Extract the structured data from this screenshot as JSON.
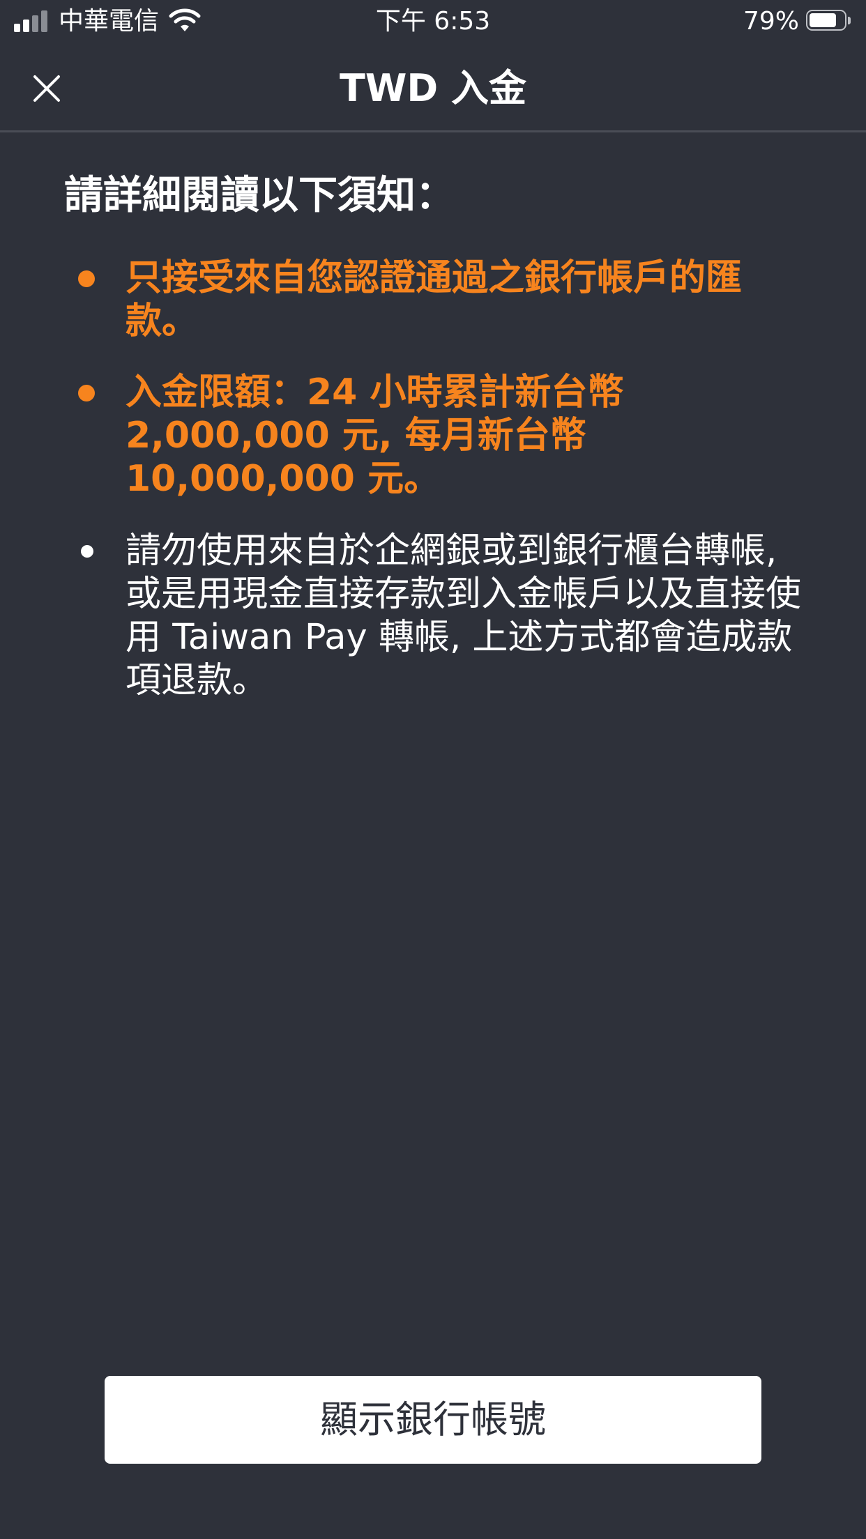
{
  "status_bar": {
    "carrier": "中華電信",
    "time": "下午 6:53",
    "battery_percent": "79%",
    "battery_level": 0.79,
    "signal_bars": 2,
    "signal_bars_total": 4,
    "icons": [
      "signal-icon",
      "wifi-icon",
      "battery-icon"
    ]
  },
  "nav": {
    "title": "TWD 入金",
    "close_icon": "close-icon"
  },
  "notice": {
    "heading": "請詳細閱讀以下須知：",
    "items": [
      {
        "text": "只接受來自您認證通過之銀行帳戶的匯款。",
        "style": "highlight"
      },
      {
        "text": "入金限額：24 小時累計新台幣 2,000,000 元, 每月新台幣 10,000,000 元。",
        "style": "highlight"
      },
      {
        "text": "請勿使用來自於企網銀或到銀行櫃台轉帳, 或是用現金直接存款到入金帳戶以及直接使用 Taiwan Pay 轉帳, 上述方式都會造成款項退款。",
        "style": "normal"
      }
    ]
  },
  "actions": {
    "show_account_label": "顯示銀行帳號"
  },
  "colors": {
    "background": "#2e313a",
    "accent": "#f7841e",
    "text": "#ffffff",
    "button_bg": "#ffffff",
    "divider": "#4a4d56"
  }
}
